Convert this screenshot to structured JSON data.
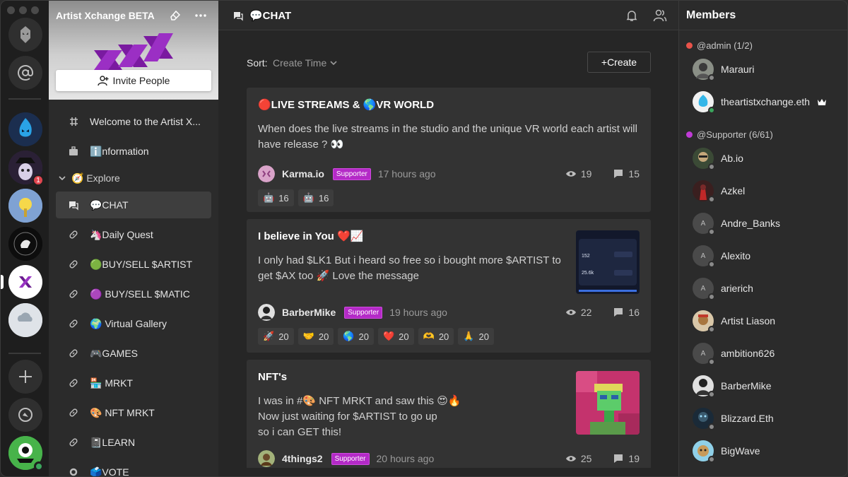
{
  "server": {
    "name": "Artist Xchange BETA",
    "invite_label": "Invite People"
  },
  "rail": {
    "badge_count": "1"
  },
  "channels": [
    {
      "label": "Welcome to the Artist X...",
      "icon": "hash-icon"
    },
    {
      "label": "ℹ️nformation",
      "icon": "briefcase-icon"
    },
    {
      "label": "🧭 Explore",
      "icon": "chevron-down-icon",
      "category": true
    },
    {
      "label": "💬CHAT",
      "icon": "chat-icon",
      "active": true
    },
    {
      "label": "🦄Daily Quest",
      "icon": "link-icon"
    },
    {
      "label": "🟢BUY/SELL $ARTIST",
      "icon": "link-icon"
    },
    {
      "label": "🟣 BUY/SELL $MATIC",
      "icon": "link-icon"
    },
    {
      "label": "🌍 Virtual Gallery",
      "icon": "link-icon"
    },
    {
      "label": "🎮GAMES",
      "icon": "link-icon"
    },
    {
      "label": "🏪 MRKT",
      "icon": "link-icon"
    },
    {
      "label": "🎨 NFT MRKT",
      "icon": "link-icon"
    },
    {
      "label": "📓LEARN",
      "icon": "link-icon"
    },
    {
      "label": "🗳️VOTE",
      "icon": "gear-icon"
    }
  ],
  "header": {
    "title": "💬CHAT"
  },
  "sort": {
    "label": "Sort:",
    "value": "Create Time",
    "create_label": "+Create"
  },
  "posts": [
    {
      "title": "🔴LIVE STREAMS & 🌎VR WORLD",
      "body": "When does the live streams in the studio and the unique VR world each artist will have release ? 👀",
      "author": "Karma.io",
      "role": "Supporter",
      "time": "17 hours ago",
      "views": "19",
      "comments": "15",
      "reactions": [
        {
          "emoji": "🤖",
          "count": "16"
        },
        {
          "emoji": "🤖",
          "count": "16"
        }
      ]
    },
    {
      "title": "I believe in You ❤️📈",
      "body": "I only had $LK1 But i heard so free so i bought more $ARTIST to get $AX too 🚀 Love the message",
      "author": "BarberMike",
      "role": "Supporter",
      "time": "19 hours ago",
      "views": "22",
      "comments": "16",
      "thumb_text": [
        "152",
        "25.6k"
      ],
      "reactions": [
        {
          "emoji": "🚀",
          "count": "20"
        },
        {
          "emoji": "🤝",
          "count": "20"
        },
        {
          "emoji": "🌎",
          "count": "20"
        },
        {
          "emoji": "❤️",
          "count": "20"
        },
        {
          "emoji": "🫶",
          "count": "20"
        },
        {
          "emoji": "🙏",
          "count": "20"
        }
      ]
    },
    {
      "title": "NFT's",
      "body_lines": [
        "I was in #🎨 NFT MRKT and saw this 😍🔥",
        "Now just waiting for $ARTIST to go up",
        "so i can  GET this!"
      ],
      "author": "4things2",
      "role": "Supporter",
      "time": "20 hours ago",
      "views": "25",
      "comments": "19"
    }
  ],
  "members": {
    "title": "Members",
    "groups": [
      {
        "label": "@admin (1/2)",
        "color": "#e9534a",
        "items": [
          {
            "name": "Marauri",
            "online": false
          },
          {
            "name": "theartistxchange.eth",
            "online": true,
            "crown": true
          }
        ]
      },
      {
        "label": "@Supporter (6/61)",
        "color": "#c03bd6",
        "items": [
          {
            "name": "Ab.io",
            "online": false
          },
          {
            "name": "Azkel",
            "online": false
          },
          {
            "name": "Andre_Banks",
            "online": false,
            "letter": "A"
          },
          {
            "name": "Alexito",
            "online": false,
            "letter": "A"
          },
          {
            "name": "arierich",
            "online": false,
            "letter": "A"
          },
          {
            "name": "Artist Liason",
            "online": false
          },
          {
            "name": "ambition626",
            "online": false,
            "letter": "A"
          },
          {
            "name": "BarberMike",
            "online": false
          },
          {
            "name": "Blizzard.Eth",
            "online": false
          },
          {
            "name": "BigWave",
            "online": false
          }
        ]
      }
    ]
  },
  "colors": {
    "accent_role": "#b42ac7",
    "online": "#3ba55d",
    "notification": "#e0454f"
  }
}
